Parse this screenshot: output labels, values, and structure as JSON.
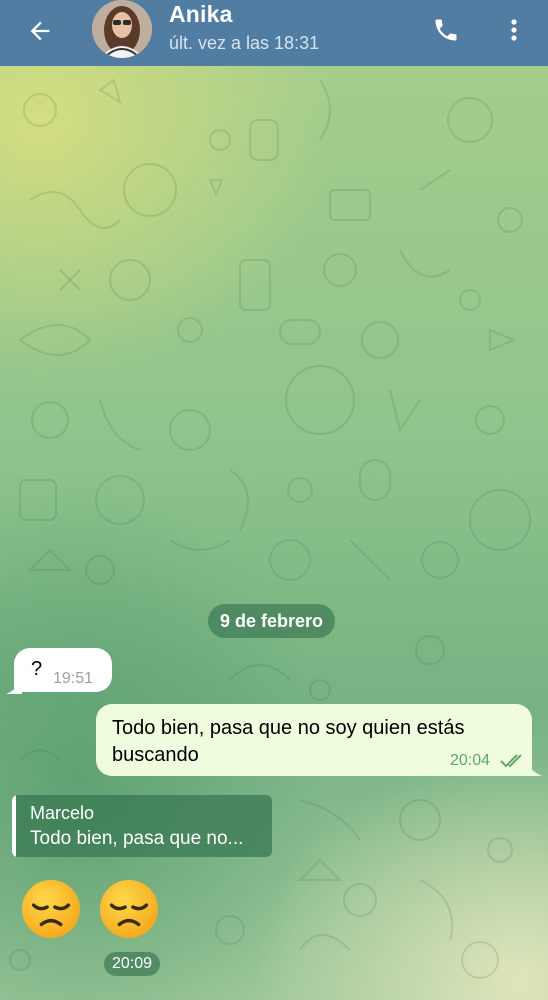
{
  "header": {
    "contact_name": "Anika",
    "last_seen": "últ. vez a las 18:31",
    "back_icon": "arrow-left-icon",
    "call_icon": "phone-icon",
    "menu_icon": "dots-vertical-icon"
  },
  "chat": {
    "date_separator": "9 de febrero",
    "messages": [
      {
        "direction": "incoming",
        "text": "?",
        "time": "19:51"
      },
      {
        "direction": "outgoing",
        "text": "Todo bien, pasa que no soy quien estás buscando",
        "time": "20:04",
        "status": "read"
      },
      {
        "direction": "incoming",
        "reply_to": {
          "name": "Marcelo",
          "text": "Todo bien, pasa que no..."
        },
        "emojis": [
          "disappointed-face",
          "disappointed-face"
        ],
        "time": "20:09"
      }
    ]
  },
  "colors": {
    "header_bg": "#517da2",
    "outgoing_bubble": "#effdde",
    "incoming_bubble": "#ffffff",
    "read_check": "#5fa863"
  }
}
